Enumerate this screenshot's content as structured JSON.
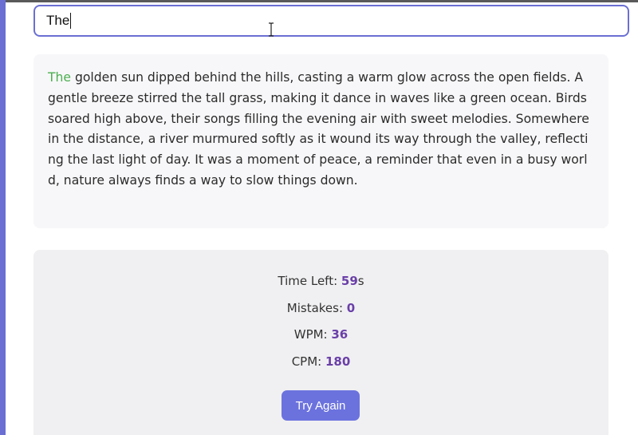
{
  "input": {
    "value": "The",
    "caret_icon": "text-caret",
    "cursor_icon": "ibeam-cursor-icon"
  },
  "passage": {
    "typed": "The",
    "remaining": " golden sun dipped behind the hills, casting a warm glow across the open fields.  A gentle breeze stirred the tall grass, making it dance in waves like a green ocean. Birds soared high above, their songs filling the evening air with sweet melodies. Somewhere in the distance, a river murmured softly as it wound its way through the valley, reflecting the last light of day. It was a moment of peace, a reminder that even in a busy world, nature always finds a way to slow things down."
  },
  "stats": {
    "time_label": "Time Left: ",
    "time_value": "59",
    "time_unit": "s",
    "mistakes_label": "Mistakes: ",
    "mistakes_value": "0",
    "wpm_label": "WPM: ",
    "wpm_value": "36",
    "cpm_label": "CPM: ",
    "cpm_value": "180"
  },
  "button": {
    "label": "Try Again"
  },
  "colors": {
    "accent": "#6b6fd3",
    "typed_correct": "#4caf50",
    "stat_value": "#6a3fa8",
    "button": "#6b72de"
  }
}
